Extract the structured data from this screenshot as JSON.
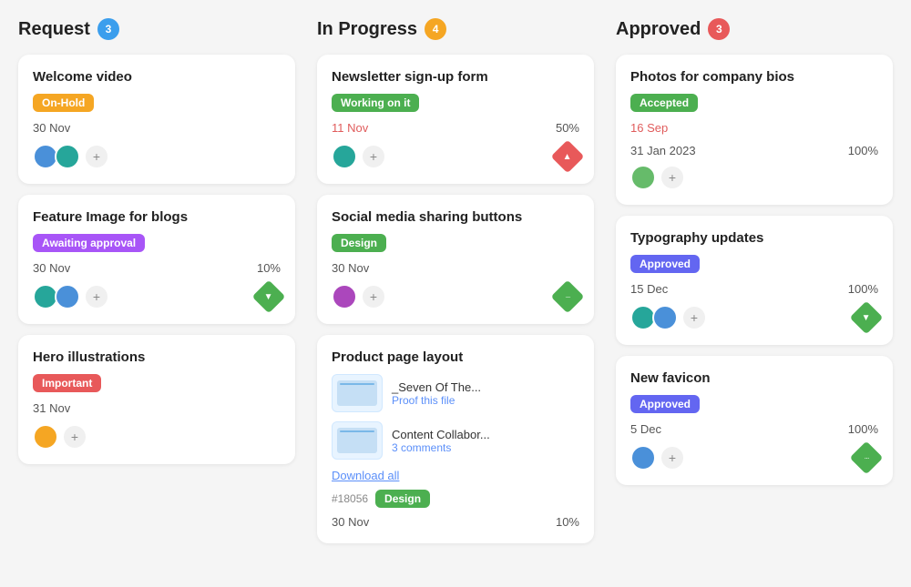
{
  "columns": [
    {
      "id": "request",
      "title": "Request",
      "badge": "3",
      "badge_color": "badge-blue",
      "cards": [
        {
          "id": "card-welcome",
          "title": "Welcome video",
          "tag": "On-Hold",
          "tag_class": "tag-on-hold",
          "date": "30 Nov",
          "date_color": "black",
          "avatars": [
            "blue",
            "teal"
          ],
          "show_add": true,
          "percent": null,
          "icon": null
        },
        {
          "id": "card-feature",
          "title": "Feature Image for blogs",
          "tag": "Awaiting approval",
          "tag_class": "tag-awaiting",
          "date": "30 Nov",
          "date_color": "black",
          "avatars": [
            "teal",
            "blue"
          ],
          "show_add": true,
          "percent": "10%",
          "icon": "diamond-down"
        },
        {
          "id": "card-hero",
          "title": "Hero illustrations",
          "tag": "Important",
          "tag_class": "tag-important",
          "date": "31 Nov",
          "date_color": "black",
          "avatars": [
            "orange"
          ],
          "show_add": true,
          "percent": null,
          "icon": null
        }
      ]
    },
    {
      "id": "in-progress",
      "title": "In Progress",
      "badge": "4",
      "badge_color": "badge-orange",
      "cards": [
        {
          "id": "card-newsletter",
          "title": "Newsletter sign-up form",
          "tag": "Working on it",
          "tag_class": "tag-working",
          "date": "11 Nov",
          "date_color": "red",
          "avatars": [
            "teal"
          ],
          "show_add": true,
          "percent": "50%",
          "icon": "diamond-up",
          "type": "simple"
        },
        {
          "id": "card-social",
          "title": "Social media sharing buttons",
          "tag": "Design",
          "tag_class": "tag-design",
          "date": "30 Nov",
          "date_color": "black",
          "avatars": [
            "purple"
          ],
          "show_add": true,
          "percent": null,
          "icon": "diamond-dots",
          "type": "simple"
        },
        {
          "id": "card-product",
          "title": "Product page layout",
          "tag": null,
          "date": "30 Nov",
          "date_color": "black",
          "avatars": [],
          "show_add": false,
          "percent": "10%",
          "icon": null,
          "type": "files",
          "files": [
            {
              "name": "_Seven Of The...",
              "action": "Proof this file",
              "action_color": "link"
            },
            {
              "name": "Content Collabor...",
              "action": "3 comments",
              "action_color": "link"
            }
          ],
          "download_label": "Download all",
          "ticket_id": "#18056",
          "ticket_tag": "Design",
          "ticket_tag_class": "tag-design"
        }
      ]
    },
    {
      "id": "approved",
      "title": "Approved",
      "badge": "3",
      "badge_color": "badge-red",
      "cards": [
        {
          "id": "card-photos",
          "title": "Photos for company bios",
          "tag": "Accepted",
          "tag_class": "tag-accepted",
          "date": "16 Sep",
          "date_color": "red",
          "date2": "31 Jan 2023",
          "date2_color": "black",
          "avatars": [
            "green"
          ],
          "show_add": true,
          "percent": "100%",
          "icon": null
        },
        {
          "id": "card-typography",
          "title": "Typography updates",
          "tag": "Approved",
          "tag_class": "tag-approved",
          "date": "15 Dec",
          "date_color": "black",
          "avatars": [
            "teal",
            "blue"
          ],
          "show_add": true,
          "percent": "100%",
          "icon": "diamond-down"
        },
        {
          "id": "card-favicon",
          "title": "New favicon",
          "tag": "Approved",
          "tag_class": "tag-approved",
          "date": "5 Dec",
          "date_color": "black",
          "avatars": [
            "blue"
          ],
          "show_add": true,
          "percent": "100%",
          "icon": "diamond-dots"
        }
      ]
    }
  ]
}
